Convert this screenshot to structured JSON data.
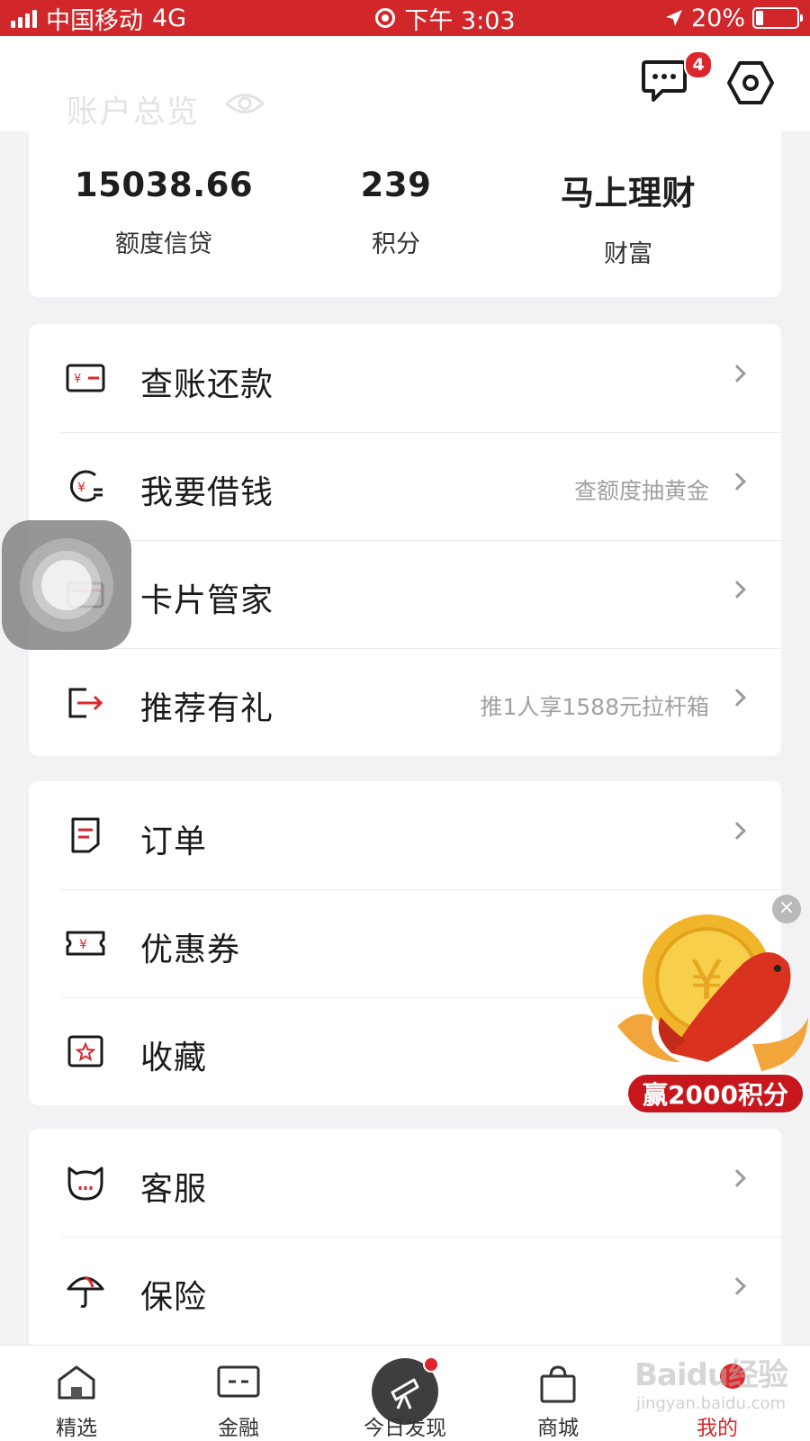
{
  "status_bar": {
    "carrier": "中国移动",
    "network": "4G",
    "time": "下午 3:03",
    "battery": "20%"
  },
  "header": {
    "title": "账户总览",
    "message_badge": "4"
  },
  "overview": {
    "stats": [
      {
        "value": "15038.66",
        "label": "额度信贷"
      },
      {
        "value": "239",
        "label": "积分"
      },
      {
        "value": "马上理财",
        "label": "财富"
      }
    ]
  },
  "menu_groups": [
    {
      "items": [
        {
          "label": "查账还款",
          "hint": "",
          "icon": "bill-repay-icon"
        },
        {
          "label": "我要借钱",
          "hint": "查额度抽黄金",
          "icon": "borrow-money-icon"
        },
        {
          "label": "卡片管家",
          "hint": "",
          "icon": "card-icon"
        },
        {
          "label": "推荐有礼",
          "hint": "推1人享1588元拉杆箱",
          "icon": "referral-icon"
        }
      ]
    },
    {
      "items": [
        {
          "label": "订单",
          "hint": "",
          "icon": "order-icon"
        },
        {
          "label": "优惠券",
          "hint": "",
          "icon": "coupon-icon"
        },
        {
          "label": "收藏",
          "hint": "",
          "icon": "favorite-icon"
        }
      ]
    },
    {
      "items": [
        {
          "label": "客服",
          "hint": "",
          "icon": "customer-service-icon"
        },
        {
          "label": "保险",
          "hint": "",
          "icon": "insurance-icon"
        }
      ]
    }
  ],
  "promo": {
    "label": "赢2000积分"
  },
  "tabbar": {
    "tabs": [
      {
        "label": "精选",
        "icon": "home-icon",
        "active": false
      },
      {
        "label": "金融",
        "icon": "finance-card-icon",
        "active": false
      },
      {
        "label": "今日发现",
        "icon": "telescope-icon",
        "active": false
      },
      {
        "label": "商城",
        "icon": "shopping-bag-icon",
        "active": false
      },
      {
        "label": "我的",
        "icon": "profile-icon",
        "active": true
      }
    ]
  },
  "watermark": {
    "brand": "Baidu经验",
    "url": "jingyan.baidu.com"
  },
  "colors": {
    "brand_red": "#d1262a",
    "accent_red": "#d9272c",
    "background": "#f2f2f4"
  }
}
